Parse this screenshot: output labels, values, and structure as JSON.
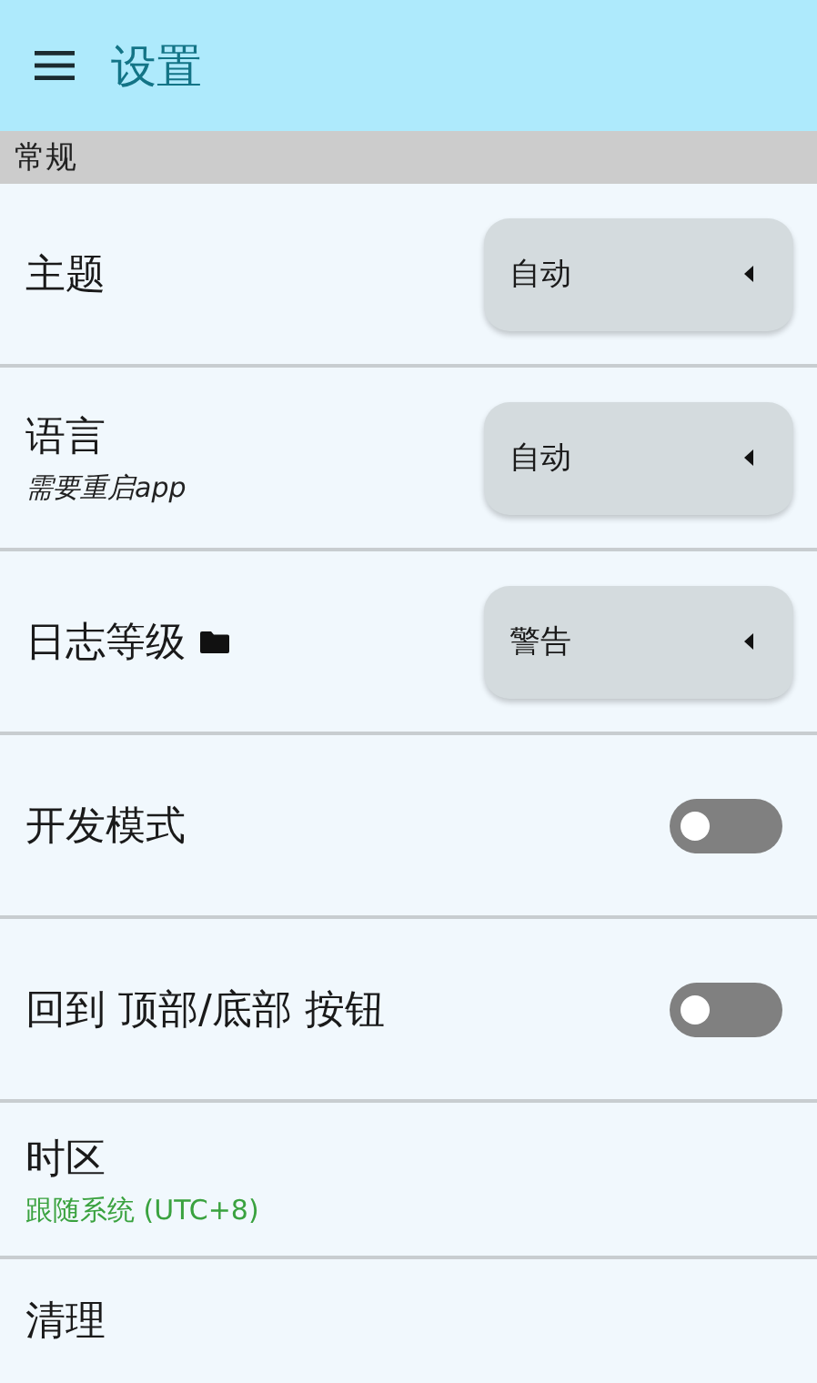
{
  "app_bar": {
    "title": "设置"
  },
  "section": {
    "title": "常规"
  },
  "settings": [
    {
      "kind": "select",
      "label": "主题",
      "value": "自动"
    },
    {
      "kind": "select",
      "label": "语言",
      "subtitle": "需要重启app",
      "value": "自动"
    },
    {
      "kind": "select",
      "label": "日志等级",
      "has_icon": true,
      "value": "警告"
    },
    {
      "kind": "switch",
      "label": "开发模式",
      "on": false
    },
    {
      "kind": "switch",
      "label": "回到 顶部/底部 按钮",
      "on": false
    },
    {
      "kind": "info",
      "label": "时区",
      "detail": "跟随系统 (UTC+8)"
    },
    {
      "kind": "plain",
      "label": "清理"
    }
  ]
}
